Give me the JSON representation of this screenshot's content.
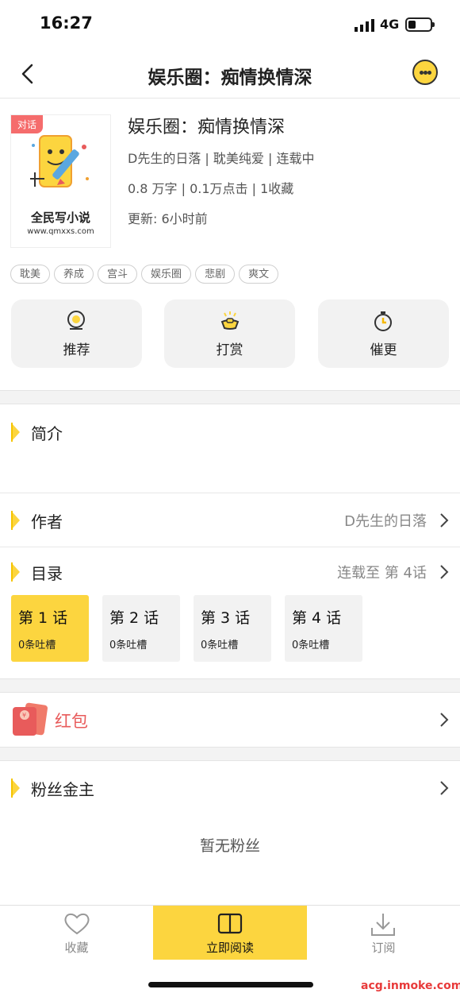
{
  "status": {
    "time": "16:27",
    "network": "4G"
  },
  "nav": {
    "title": "娱乐圈：痴情换情深"
  },
  "cover": {
    "tag": "对话",
    "brand": "全民写小说",
    "url": "www.qmxxs.com"
  },
  "book": {
    "title": "娱乐圈：痴情换情深",
    "line1": "D先生的日落 | 耽美纯爱 | 连载中",
    "line2": "0.8 万字 | 0.1万点击 | 1收藏",
    "line3": "更新: 6小时前"
  },
  "tags": [
    "耽美",
    "养成",
    "宫斗",
    "娱乐圈",
    "悲剧",
    "爽文"
  ],
  "actions": {
    "recommend": "推荐",
    "reward": "打赏",
    "urge": "催更"
  },
  "intro": {
    "title": "简介"
  },
  "author": {
    "title": "作者",
    "name": "D先生的日落"
  },
  "catalog": {
    "title": "目录",
    "progress": "连载至 第 4话",
    "chapters": [
      {
        "title": "第 1 话",
        "comments": "0条吐槽"
      },
      {
        "title": "第 2 话",
        "comments": "0条吐槽"
      },
      {
        "title": "第 3 话",
        "comments": "0条吐槽"
      },
      {
        "title": "第 4 话",
        "comments": "0条吐槽"
      }
    ]
  },
  "redpacket": {
    "label": "红包"
  },
  "fans": {
    "title": "粉丝金主",
    "empty": "暂无粉丝"
  },
  "bottom": {
    "favorite": "收藏",
    "read": "立即阅读",
    "subscribe": "订阅"
  },
  "watermark": "acg.inmoke.com",
  "colors": {
    "accent": "#fcd53f",
    "red": "#e85b5b"
  }
}
